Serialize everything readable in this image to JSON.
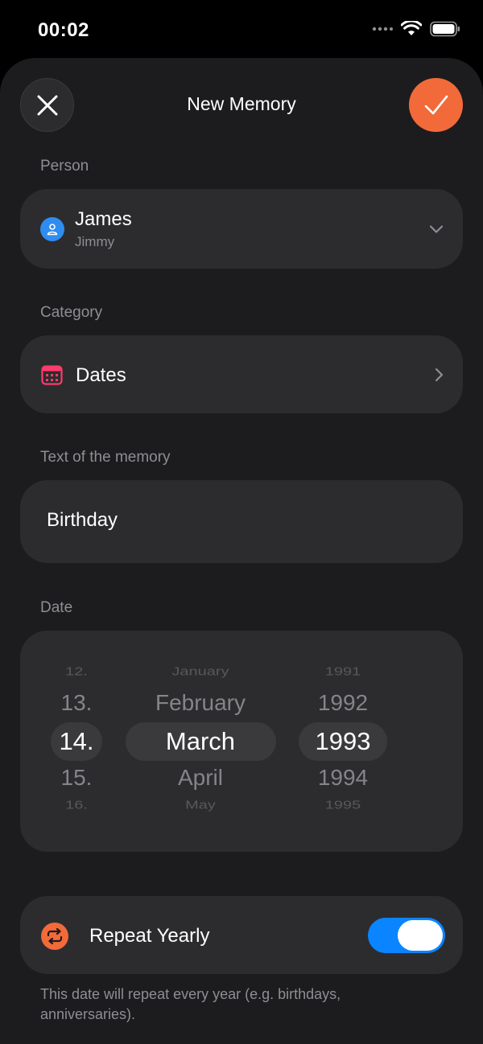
{
  "status_bar": {
    "time": "00:02"
  },
  "header": {
    "title": "New Memory",
    "close_icon": "close-icon",
    "confirm_icon": "checkmark-icon"
  },
  "person": {
    "label": "Person",
    "name": "James",
    "nickname": "Jimmy"
  },
  "category": {
    "label": "Category",
    "value": "Dates"
  },
  "memory_text": {
    "label": "Text of the memory",
    "value": "Birthday"
  },
  "date": {
    "label": "Date",
    "days": [
      "12.",
      "13.",
      "14.",
      "15.",
      "16."
    ],
    "months": [
      "January",
      "February",
      "March",
      "April",
      "May"
    ],
    "years": [
      "1991",
      "1992",
      "1993",
      "1994",
      "1995"
    ],
    "selected": {
      "day": "14.",
      "month": "March",
      "year": "1993"
    }
  },
  "repeat": {
    "label": "Repeat Yearly",
    "enabled": true,
    "footnote": "This date will repeat every year (e.g. birthdays, anniversaries)."
  },
  "colors": {
    "accent": "#f26a3a",
    "toggle_on": "#0a84ff",
    "person_avatar": "#2f8cf0",
    "calendar_icon": "#ff3b6b"
  }
}
